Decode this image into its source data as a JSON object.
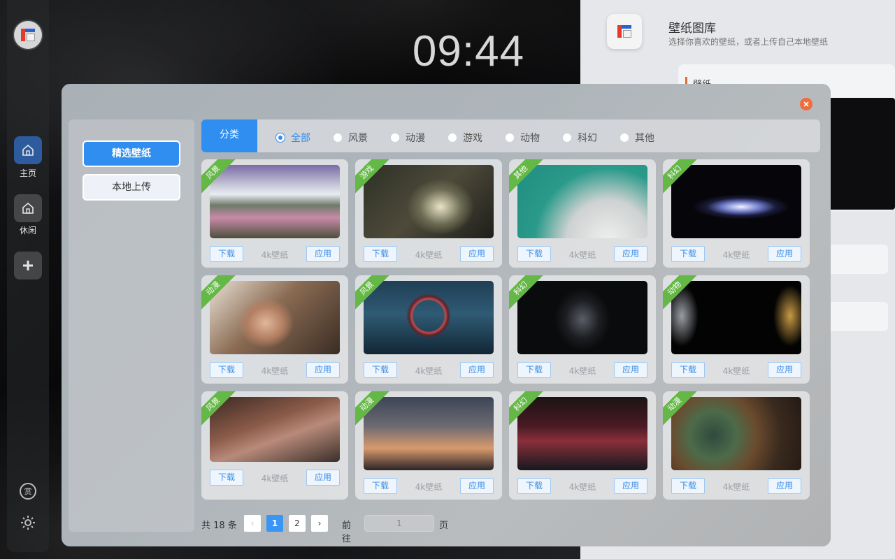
{
  "desktop": {
    "clock": "09:44",
    "rail": {
      "home_label": "主页",
      "leisure_label": "休闲",
      "reward_icon_text": "赏"
    }
  },
  "app": {
    "title": "壁纸图库",
    "subtitle": "选择你喜欢的壁纸，或者上传自己本地壁纸",
    "side_card_label": "壁纸"
  },
  "modal": {
    "menu": {
      "featured": "精选壁纸",
      "upload": "本地上传"
    },
    "filter": {
      "title": "分类",
      "options": [
        "全部",
        "风景",
        "动漫",
        "游戏",
        "动物",
        "科幻",
        "其他"
      ],
      "selected": "全部"
    },
    "card_actions": {
      "download": "下载",
      "apply": "应用"
    },
    "cards": [
      {
        "tag": "风景",
        "resolution": "4k壁纸"
      },
      {
        "tag": "游戏",
        "resolution": "4k壁纸"
      },
      {
        "tag": "其他",
        "resolution": "4k壁纸"
      },
      {
        "tag": "科幻",
        "resolution": "4k壁纸"
      },
      {
        "tag": "动漫",
        "resolution": "4k壁纸"
      },
      {
        "tag": "风景",
        "resolution": "4k壁纸"
      },
      {
        "tag": "科幻",
        "resolution": "4k壁纸"
      },
      {
        "tag": "动物",
        "resolution": "4k壁纸"
      },
      {
        "tag": "风景",
        "resolution": "4k壁纸"
      },
      {
        "tag": "动漫",
        "resolution": "4k壁纸"
      },
      {
        "tag": "科幻",
        "resolution": "4k壁纸"
      },
      {
        "tag": "动漫",
        "resolution": "4k壁纸"
      }
    ],
    "pagination": {
      "total": "共 18 条",
      "prev": "‹",
      "pages": [
        "1",
        "2"
      ],
      "current": "1",
      "next": "›",
      "goto_label": "前往",
      "goto_value": "1",
      "goto_unit": "页"
    }
  },
  "colors": {
    "primary": "#2f8ef0",
    "tag_green": "#64b845",
    "close_orange": "#ef6d3b"
  }
}
